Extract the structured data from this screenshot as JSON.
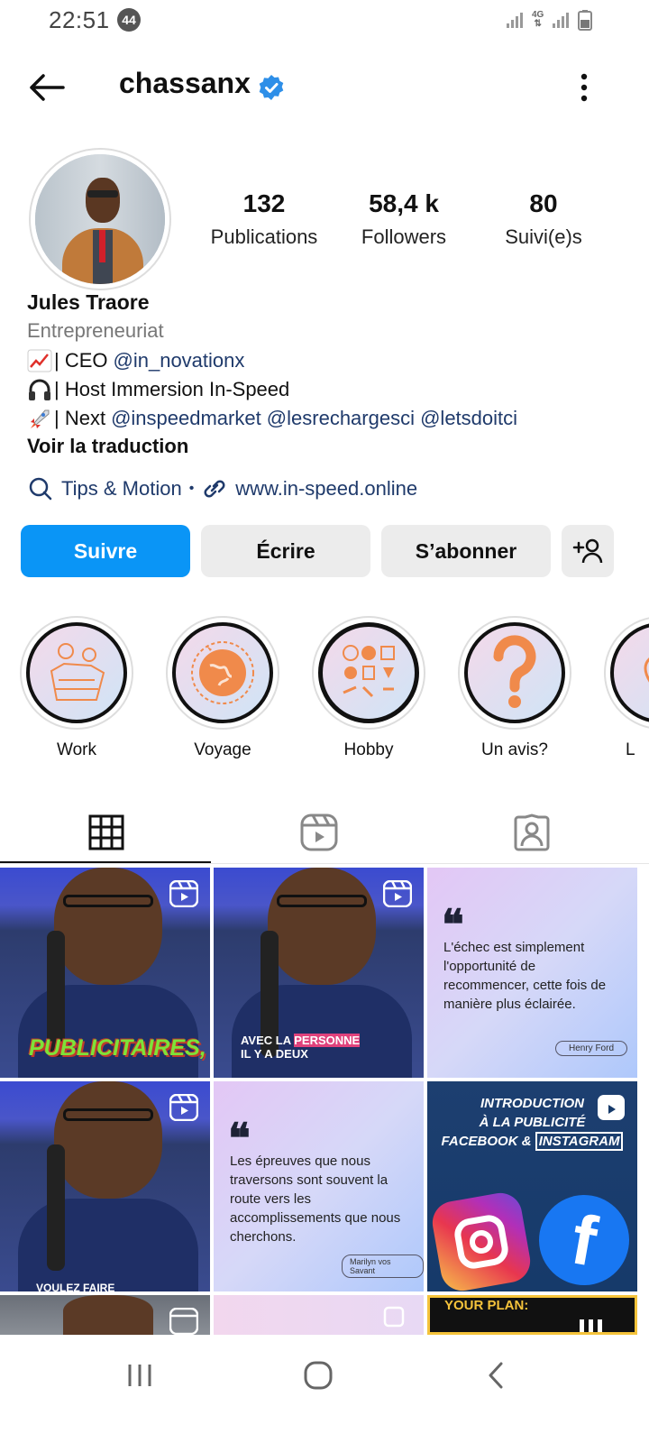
{
  "status": {
    "time": "22:51",
    "notification_count": "44",
    "network": "4G"
  },
  "header": {
    "username": "chassanx"
  },
  "stats": [
    {
      "value": "132",
      "label": "Publications"
    },
    {
      "value": "58,4 k",
      "label": "Followers"
    },
    {
      "value": "80",
      "label": "Suivi(e)s"
    }
  ],
  "profile": {
    "name": "Jules Traore",
    "category": "Entrepreneuriat",
    "bio": {
      "line1_text": "| CEO",
      "line1_mention": "@in_novationx",
      "line2_text": "| Host Immersion In-Speed",
      "line3_text": "| Next",
      "line3_mentions": "@inspeedmarket @lesrechargesci @letsdoitci"
    },
    "translate": "Voir la traduction",
    "thread_label": "Tips & Motion",
    "separator": "•",
    "website": "www.in-speed.online"
  },
  "buttons": {
    "follow": "Suivre",
    "message": "Écrire",
    "subscribe": "S’abonner"
  },
  "highlights": [
    {
      "label": "Work"
    },
    {
      "label": "Voyage"
    },
    {
      "label": "Hobby"
    },
    {
      "label": "Un avis?"
    },
    {
      "label": "L"
    }
  ],
  "posts": {
    "p1_caption": "PUBLICITAIRES,",
    "p2_caption_a": "AVEC LA",
    "p2_caption_b": "PERSONNE",
    "p2_caption_c": "IL Y A DEUX",
    "p3_quote": "L'échec est simplement l'opportunité de recommencer, cette fois de manière plus éclairée.",
    "p3_author": "Henry Ford",
    "p4_caption": "VOULEZ FAIRE",
    "p5_quote": "Les épreuves que nous traversons sont souvent la route vers les accomplissements que nous cherchons.",
    "p5_author": "Marilyn vos Savant",
    "p6_line1": "INTRODUCTION",
    "p6_line2": "À LA PUBLICITÉ",
    "p6_line3a": "FACEBOOK &",
    "p6_line3b": "INSTAGRAM",
    "p9_caption": "YOUR PLAN:"
  },
  "colors": {
    "accent": "#0a95f6",
    "link": "#1f3a6b",
    "verified": "#2e8fe8",
    "caption_green": "#7de339",
    "highlight_orange": "#f08a4b"
  }
}
